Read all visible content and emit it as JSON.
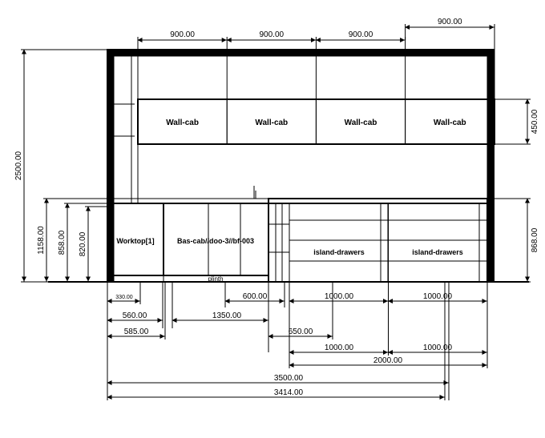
{
  "dims": {
    "top_wall1": "900.00",
    "top_wall2": "900.00",
    "top_wall3": "900.00",
    "top_wall4": "900.00",
    "left_total": "2500.00",
    "left_1158": "1158.00",
    "left_858": "858.00",
    "left_820": "820.00",
    "right_868": "868.00",
    "right_450": "450.00",
    "bot_330": "330.00",
    "bot_560": "560.00",
    "bot_585": "585.00",
    "bot_600": "600.00",
    "bot_1350": "1350.00",
    "bot_650": "650.00",
    "bot_1000a": "1000.00",
    "bot_1000b": "1000.00",
    "bot_1000c": "1000.00",
    "bot_1000d": "1000.00",
    "bot_2000": "2000.00",
    "bot_3500": "3500.00",
    "bot_3414": "3414.00"
  },
  "labels": {
    "wallcab": "Wall-cab",
    "worktop": "Worktop[1]",
    "bascab": "Bas-cab//doo-3//bf-003",
    "island": "island-drawers",
    "plinth": "plinth"
  }
}
